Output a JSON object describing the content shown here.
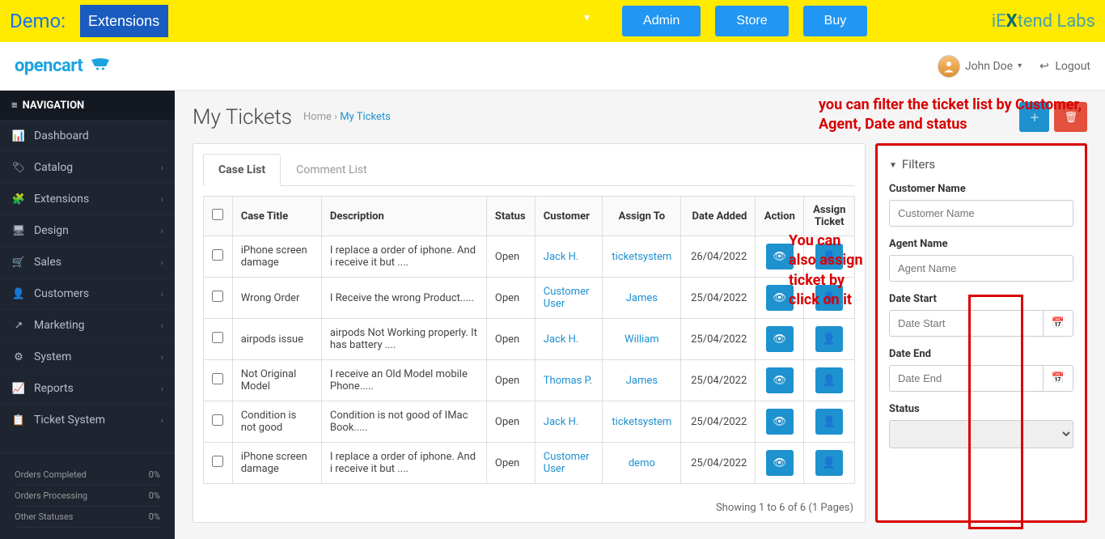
{
  "demo": {
    "label": "Demo:",
    "select_value": "Extensions",
    "btns": {
      "admin": "Admin",
      "store": "Store",
      "buy": "Buy"
    },
    "brand_left": "iE",
    "brand_x": "X",
    "brand_right": "tend Labs"
  },
  "header": {
    "logo": "opencart",
    "user": "John Doe",
    "logout": "Logout"
  },
  "sidebar": {
    "title": "NAVIGATION",
    "items": [
      {
        "icon": "📊",
        "label": "Dashboard",
        "chev": false
      },
      {
        "icon": "🏷",
        "label": "Catalog",
        "chev": true
      },
      {
        "icon": "🧩",
        "label": "Extensions",
        "chev": true
      },
      {
        "icon": "🖥",
        "label": "Design",
        "chev": true
      },
      {
        "icon": "🛒",
        "label": "Sales",
        "chev": true
      },
      {
        "icon": "👤",
        "label": "Customers",
        "chev": true
      },
      {
        "icon": "↗",
        "label": "Marketing",
        "chev": true
      },
      {
        "icon": "⚙",
        "label": "System",
        "chev": true
      },
      {
        "icon": "📈",
        "label": "Reports",
        "chev": true
      },
      {
        "icon": "📋",
        "label": "Ticket System",
        "chev": true
      }
    ],
    "stats": [
      {
        "label": "Orders Completed",
        "val": "0%"
      },
      {
        "label": "Orders Processing",
        "val": "0%"
      },
      {
        "label": "Other Statuses",
        "val": "0%"
      }
    ]
  },
  "page": {
    "title": "My Tickets",
    "breadcrumb_home": "Home",
    "breadcrumb_sep": " › ",
    "breadcrumb_current": "My Tickets"
  },
  "annotations": {
    "filter": "you can filter the ticket list by Customer, Agent, Date and status",
    "assign": "You can also assign ticket by click on it"
  },
  "tabs": {
    "case": "Case List",
    "comment": "Comment List"
  },
  "columns": {
    "title": "Case Title",
    "desc": "Description",
    "status": "Status",
    "customer": "Customer",
    "assign": "Assign To",
    "date": "Date Added",
    "action": "Action",
    "assign_ticket": "Assign Ticket"
  },
  "rows": [
    {
      "title": "iPhone screen damage",
      "desc": "I replace a order of iphone. And i receive it but ....",
      "status": "Open",
      "customer": "Jack H.",
      "assign": "ticketsystem",
      "date": "26/04/2022"
    },
    {
      "title": "Wrong Order",
      "desc": "I Receive the wrong Product.....",
      "status": "Open",
      "customer": "Customer User",
      "assign": "James",
      "date": "25/04/2022"
    },
    {
      "title": "airpods issue",
      "desc": "airpods Not Working properly. It has battery ....",
      "status": "Open",
      "customer": "Jack H.",
      "assign": "William",
      "date": "25/04/2022"
    },
    {
      "title": "Not Original Model",
      "desc": "I receive an Old Model mobile Phone.....",
      "status": "Open",
      "customer": "Thomas P.",
      "assign": "James",
      "date": "25/04/2022"
    },
    {
      "title": "Condition is not good",
      "desc": "Condition is not good of IMac Book.....",
      "status": "Open",
      "customer": "Jack H.",
      "assign": "ticketsystem",
      "date": "25/04/2022"
    },
    {
      "title": "iPhone screen damage",
      "desc": "I replace a order of iphone. And i receive it but ....",
      "status": "Open",
      "customer": "Customer User",
      "assign": "demo",
      "date": "25/04/2022"
    }
  ],
  "pager": "Showing 1 to 6 of 6 (1 Pages)",
  "filters": {
    "title": "Filters",
    "customer": {
      "label": "Customer Name",
      "ph": "Customer Name"
    },
    "agent": {
      "label": "Agent Name",
      "ph": "Agent Name"
    },
    "date_start": {
      "label": "Date Start",
      "ph": "Date Start"
    },
    "date_end": {
      "label": "Date End",
      "ph": "Date End"
    },
    "status": {
      "label": "Status"
    }
  }
}
